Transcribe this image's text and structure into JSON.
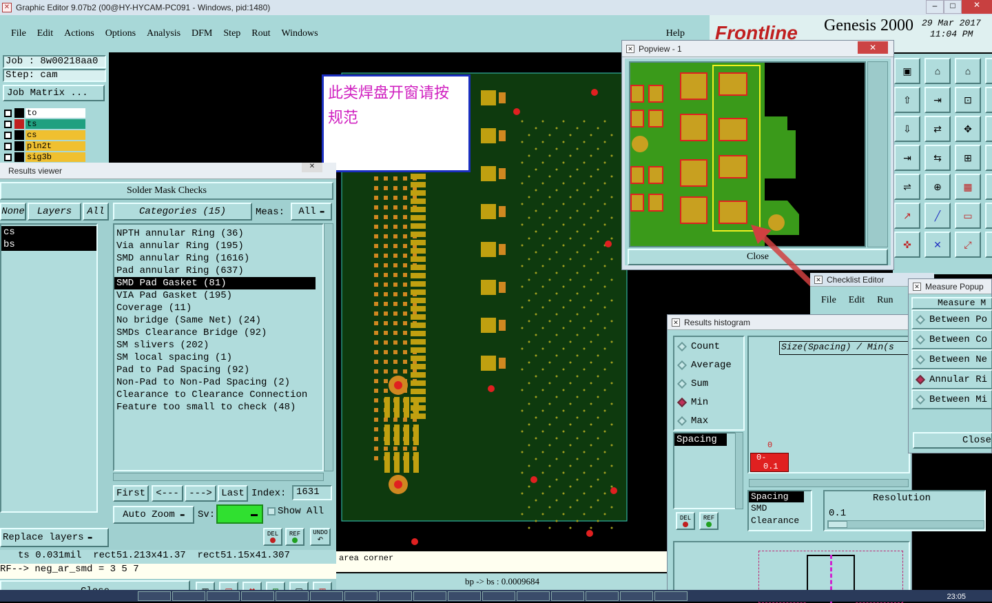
{
  "app": {
    "title": "Graphic Editor 9.07b2 (00@HY-HYCAM-PC091 - Windows, pid:1480)",
    "brand": "Frontline",
    "product": "Genesis 2000",
    "date": "29 Mar 2017",
    "time": "11:04 PM",
    "help": "Help"
  },
  "menu": [
    "File",
    "Edit",
    "Actions",
    "Options",
    "Analysis",
    "DFM",
    "Step",
    "Rout",
    "Windows"
  ],
  "job": {
    "job_label": "Job : 8w00218aa0",
    "step_label": "Step: cam",
    "matrix_button": "Job Matrix ..."
  },
  "layers": [
    {
      "name": "to",
      "color": "#ffffff"
    },
    {
      "name": "ts",
      "color": "#20a080"
    },
    {
      "name": "cs",
      "color": "#f0c030"
    },
    {
      "name": "pln2t",
      "color": "#f0c030"
    },
    {
      "name": "sig3b",
      "color": "#f0c030"
    }
  ],
  "annotation": {
    "line1": "此类焊盘开窗请按",
    "line2": "规范"
  },
  "results_viewer": {
    "title": "Results viewer",
    "header": "Solder Mask Checks",
    "none_btn": "None",
    "layers_btn": "Layers",
    "all_btn": "All",
    "categories_btn": "Categories (15)",
    "meas_label": "Meas:",
    "meas_value": "All",
    "layer_items": [
      "cs",
      "bs"
    ],
    "categories": [
      "NPTH annular Ring (36)",
      "Via annular Ring (195)",
      "SMD annular Ring (1616)",
      "Pad annular Ring (637)",
      "SMD Pad Gasket (81)",
      "VIA Pad Gasket (195)",
      "Coverage (11)",
      "No bridge (Same Net) (24)",
      "SMDs Clearance Bridge (92)",
      "SM slivers (202)",
      "SM local spacing (1)",
      "Pad to Pad Spacing (92)",
      "Non-Pad to Non-Pad Spacing (2)",
      "Clearance to Clearance Connection",
      "Feature too small to check (48)"
    ],
    "selected_index": 4,
    "nav": {
      "first": "First",
      "prev": "<---",
      "next": "--->",
      "last": "Last",
      "index_label": "Index:",
      "index_value": "1631"
    },
    "auto_zoom": "Auto Zoom",
    "sv_label": "Sv:",
    "show_all": "Show All",
    "replace_layers": "Replace layers",
    "del": "DEL",
    "ref": "REF",
    "undo": "UNDO",
    "status1": "ts 0.031mil  rect51.213x41.37  rect51.15x41.307",
    "status2": "RF--> neg_ar_smd = 3 5 7",
    "close": "Close"
  },
  "canvas_status": {
    "hint": "area corner",
    "measure": "bp -> bs : 0.0009684"
  },
  "popview": {
    "title": "Popview - 1",
    "close": "Close"
  },
  "checklist": {
    "title": "Checklist Editor",
    "menu": [
      "File",
      "Edit",
      "Run"
    ]
  },
  "histogram": {
    "title": "Results histogram",
    "options": [
      "Count",
      "Average",
      "Sum",
      "Min",
      "Max"
    ],
    "selected": "Min",
    "list_items": [
      "Spacing"
    ],
    "axis_title": "Size(Spacing) / Min(s",
    "bin_zero": "0",
    "bin_label_top": "0-",
    "bin_label_bottom": "0.1",
    "types": [
      "Spacing",
      "SMD",
      "Clearance"
    ],
    "resolution_label": "Resolution",
    "resolution_value": "0.1",
    "del": "DEL",
    "ref": "REF"
  },
  "measure_popup": {
    "title": "Measure Popup",
    "header": "Measure M",
    "options": [
      "Between Po",
      "Between Co",
      "Between Ne",
      "Annular Ri",
      "Between Mi"
    ],
    "selected": "Annular Ri",
    "close": "Close"
  },
  "taskbar": {
    "clock": "23:05"
  }
}
